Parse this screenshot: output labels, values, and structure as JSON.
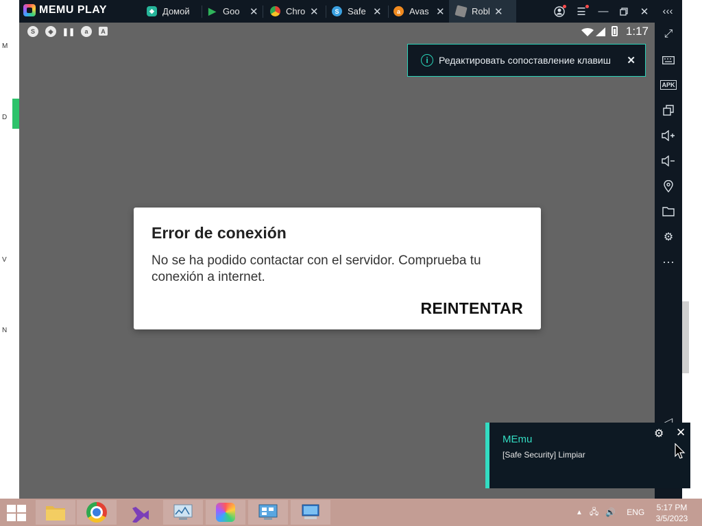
{
  "app": {
    "name": "MEMU PLAY"
  },
  "tabs": [
    {
      "label": "Домой",
      "icon": "home-icon",
      "color": "#26b59a"
    },
    {
      "label": "Goo",
      "icon": "google-play-icon",
      "color": "#2fb35a"
    },
    {
      "label": "Chro",
      "icon": "chrome-icon",
      "color": "#e34133"
    },
    {
      "label": "Safe",
      "icon": "safe-security-icon",
      "color": "#3aa0e0"
    },
    {
      "label": "Avas",
      "icon": "avast-icon",
      "color": "#f08a1f"
    },
    {
      "label": "Robl",
      "icon": "roblox-icon",
      "color": "#888888"
    }
  ],
  "android_status": {
    "time": "1:17"
  },
  "toast": {
    "text": "Редактировать сопоставление клавиш"
  },
  "dialog": {
    "title": "Error de conexión",
    "message": "No se ha podido contactar con el servidor. Comprueba tu conexión a internet.",
    "button": "REINTENTAR"
  },
  "notification": {
    "title": "MEmu",
    "body": "[Safe Security] Limpiar"
  },
  "taskbar": {
    "language": "ENG",
    "time": "5:17 PM",
    "date": "3/5/2023"
  },
  "background_app": {
    "letters": [
      "M",
      "D",
      "V",
      "N"
    ]
  },
  "colors": {
    "accent": "#2ad3b8",
    "emu_dark": "#0f1822",
    "screen_gray": "#646464"
  }
}
